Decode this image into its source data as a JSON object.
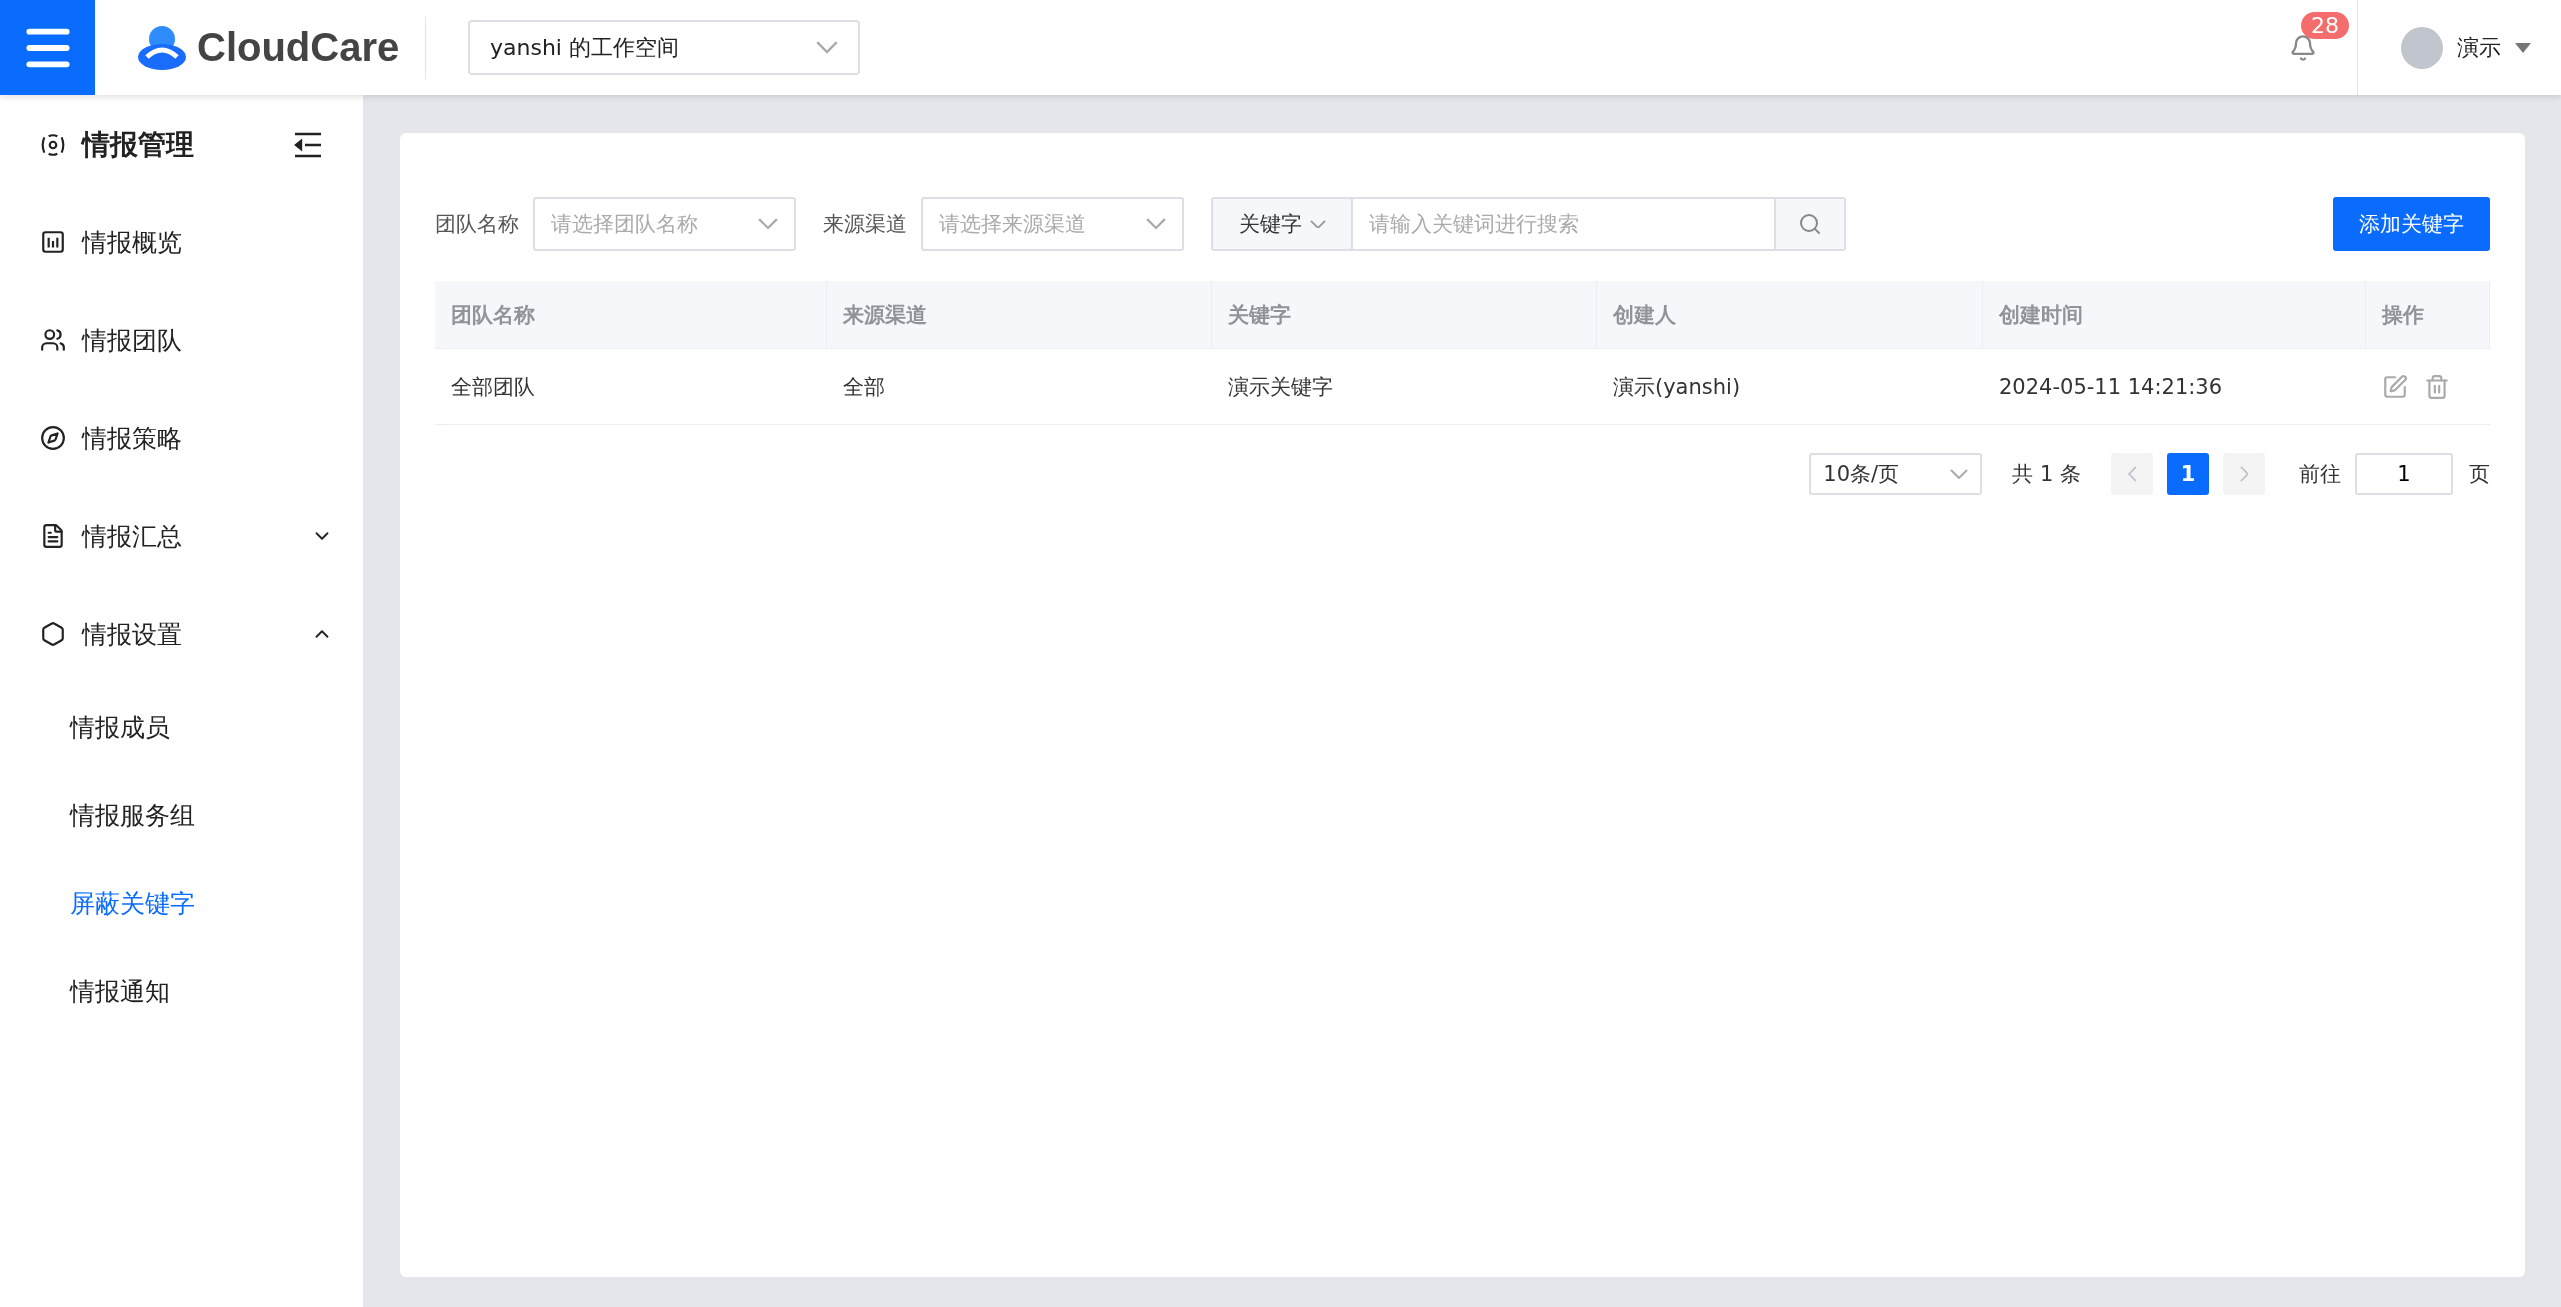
{
  "header": {
    "brand": "CloudCare",
    "workspace": "yanshi 的工作空间",
    "notifications": "28",
    "user": "演示"
  },
  "sidebar": {
    "title": "情报管理",
    "items": [
      {
        "label": "情报概览",
        "kind": "link",
        "selected": false
      },
      {
        "label": "情报团队",
        "kind": "link",
        "selected": false
      },
      {
        "label": "情报策略",
        "kind": "link",
        "selected": false
      },
      {
        "label": "情报汇总",
        "kind": "group",
        "selected": false,
        "expanded": false
      },
      {
        "label": "情报设置",
        "kind": "group",
        "selected": false,
        "expanded": true,
        "children": [
          {
            "label": "情报成员",
            "selected": false
          },
          {
            "label": "情报服务组",
            "selected": false
          },
          {
            "label": "屏蔽关键字",
            "selected": true
          },
          {
            "label": "情报通知",
            "selected": false
          }
        ]
      }
    ]
  },
  "filters": [
    {
      "label": "团队名称",
      "placeholder": "请选择团队名称"
    },
    {
      "label": "来源渠道",
      "placeholder": "请选择来源渠道"
    }
  ],
  "search": {
    "scope": "关键字",
    "placeholder": "请输入关键词进行搜索"
  },
  "add_button": "添加关键字",
  "table": {
    "columns": [
      "团队名称",
      "来源渠道",
      "关键字",
      "创建人",
      "创建时间",
      "操作"
    ],
    "rows": [
      {
        "cells": [
          "全部团队",
          "全部",
          "演示关键字",
          "演示(yanshi)",
          "2024-05-11 14:21:36"
        ]
      }
    ]
  },
  "pagination": {
    "page_size": "10条/页",
    "total": "共 1 条",
    "pages": [
      {
        "label": "1",
        "selected": true
      }
    ],
    "goto_label": "前往",
    "goto_value": "1",
    "page_unit": "页"
  }
}
